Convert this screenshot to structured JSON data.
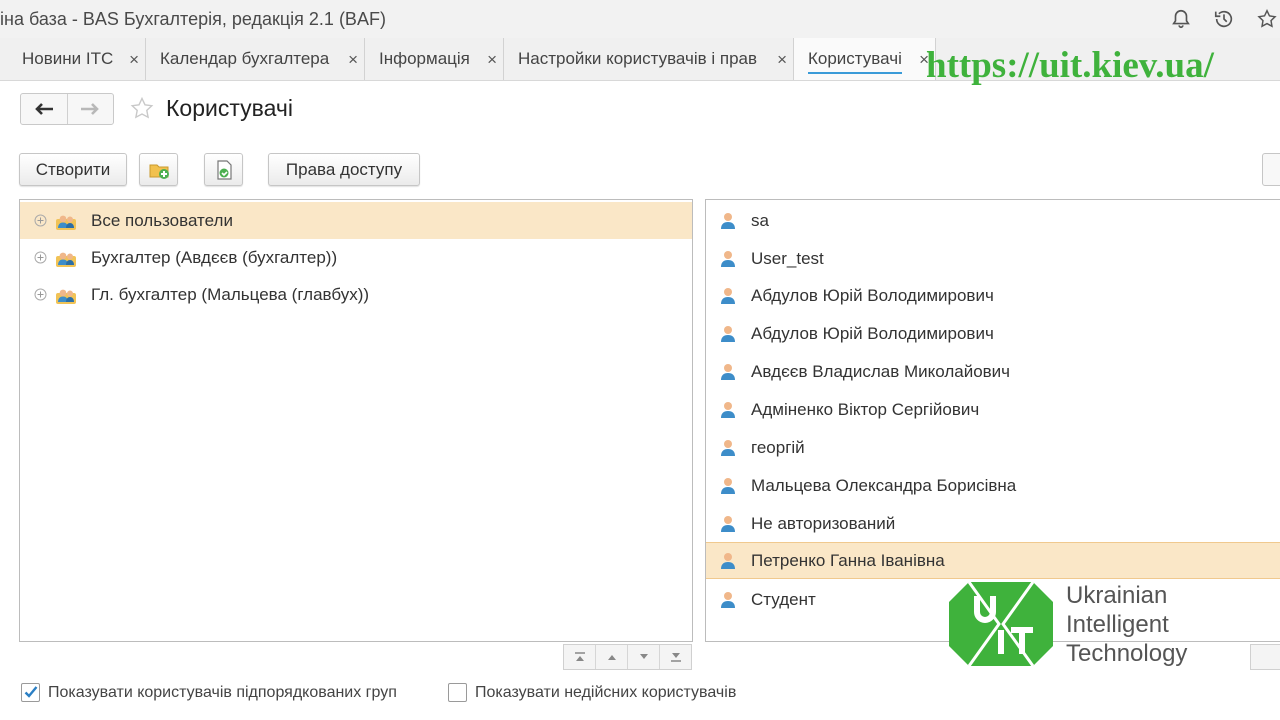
{
  "window": {
    "title": "іна база - BAS Бухгалтерія, редакція 2.1  (BAF)",
    "icons": [
      "bell-icon",
      "history-icon",
      "star-icon"
    ]
  },
  "tabs": [
    {
      "label": "Новини ІТС",
      "active": false
    },
    {
      "label": "Календар бухгалтера",
      "active": false
    },
    {
      "label": "Інформація",
      "active": false
    },
    {
      "label": "Настройки користувачів і прав",
      "active": false
    },
    {
      "label": "Користувачі",
      "active": true
    }
  ],
  "tab_close_glyph": "×",
  "overlay_url": "https://uit.kiev.ua/",
  "page": {
    "title": "Користувачі"
  },
  "toolbar": {
    "create_label": "Створити",
    "create_group_icon": "folder-add-icon",
    "copy_icon": "document-copy-icon",
    "access_rights_label": "Права доступу"
  },
  "groups": [
    {
      "label": "Все пользователи",
      "selected": true
    },
    {
      "label": "Бухгалтер (Авдєєв (бухгалтер))",
      "selected": false
    },
    {
      "label": "Гл. бухгалтер (Мальцева (главбух))",
      "selected": false
    }
  ],
  "users": [
    {
      "label": "sa",
      "selected": false
    },
    {
      "label": "User_test",
      "selected": false
    },
    {
      "label": "Абдулов Юрій Володимирович",
      "selected": false
    },
    {
      "label": "Абдулов Юрій Володимирович",
      "selected": false
    },
    {
      "label": "Авдєєв Владислав Миколайович",
      "selected": false
    },
    {
      "label": "Адміненко Віктор Сергійович",
      "selected": false
    },
    {
      "label": "георгій",
      "selected": false
    },
    {
      "label": "Мальцева Олександра Борисівна",
      "selected": false
    },
    {
      "label": "Не авторизований",
      "selected": false
    },
    {
      "label": "Петренко Ганна Іванівна",
      "selected": true
    },
    {
      "label": "Студент",
      "selected": false
    }
  ],
  "footer": {
    "show_subordinate": {
      "label": "Показувати користувачів підпорядкованих груп",
      "checked": true
    },
    "show_inactive": {
      "label": "Показувати недійсних користувачів",
      "checked": false
    }
  },
  "logo": {
    "mark_letters": "UIT",
    "lines": [
      "Ukrainian",
      "Intelligent",
      "Technology"
    ],
    "color": "#3fb23c"
  },
  "colors": {
    "selection": "#fae7c7",
    "tab_underline": "#3a9bd8",
    "checkbox_tick": "#2b7fc4",
    "brand_green": "#3fb23c"
  }
}
